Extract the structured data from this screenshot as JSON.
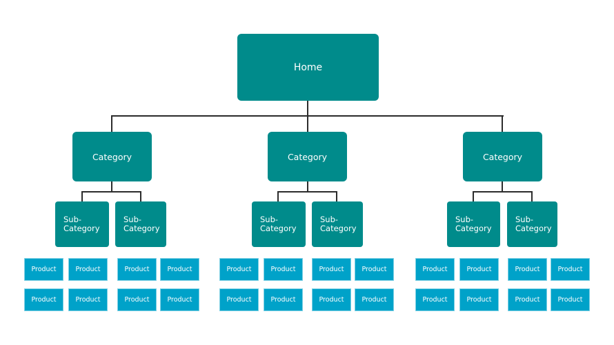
{
  "diagram": {
    "type": "site-hierarchy",
    "colors": {
      "level_primary": "#008b8b",
      "product": "#00a2c9",
      "connector": "#2b2b2b",
      "text": "#ffffff",
      "background": "#ffffff"
    },
    "root": {
      "label": "Home"
    },
    "categories": [
      {
        "label": "Category",
        "subcategories": [
          {
            "label": "Sub-\nCategory",
            "products": [
              "Product",
              "Product",
              "Product",
              "Product"
            ]
          },
          {
            "label": "Sub-\nCategory",
            "products": [
              "Product",
              "Product",
              "Product",
              "Product"
            ]
          }
        ]
      },
      {
        "label": "Category",
        "subcategories": [
          {
            "label": "Sub-\nCategory",
            "products": [
              "Product",
              "Product",
              "Product",
              "Product"
            ]
          },
          {
            "label": "Sub-\nCategory",
            "products": [
              "Product",
              "Product",
              "Product",
              "Product"
            ]
          }
        ]
      },
      {
        "label": "Category",
        "subcategories": [
          {
            "label": "Sub-\nCategory",
            "products": [
              "Product",
              "Product",
              "Product",
              "Product"
            ]
          },
          {
            "label": "Sub-\nCategory",
            "products": [
              "Product",
              "Product",
              "Product",
              "Product"
            ]
          }
        ]
      }
    ]
  }
}
